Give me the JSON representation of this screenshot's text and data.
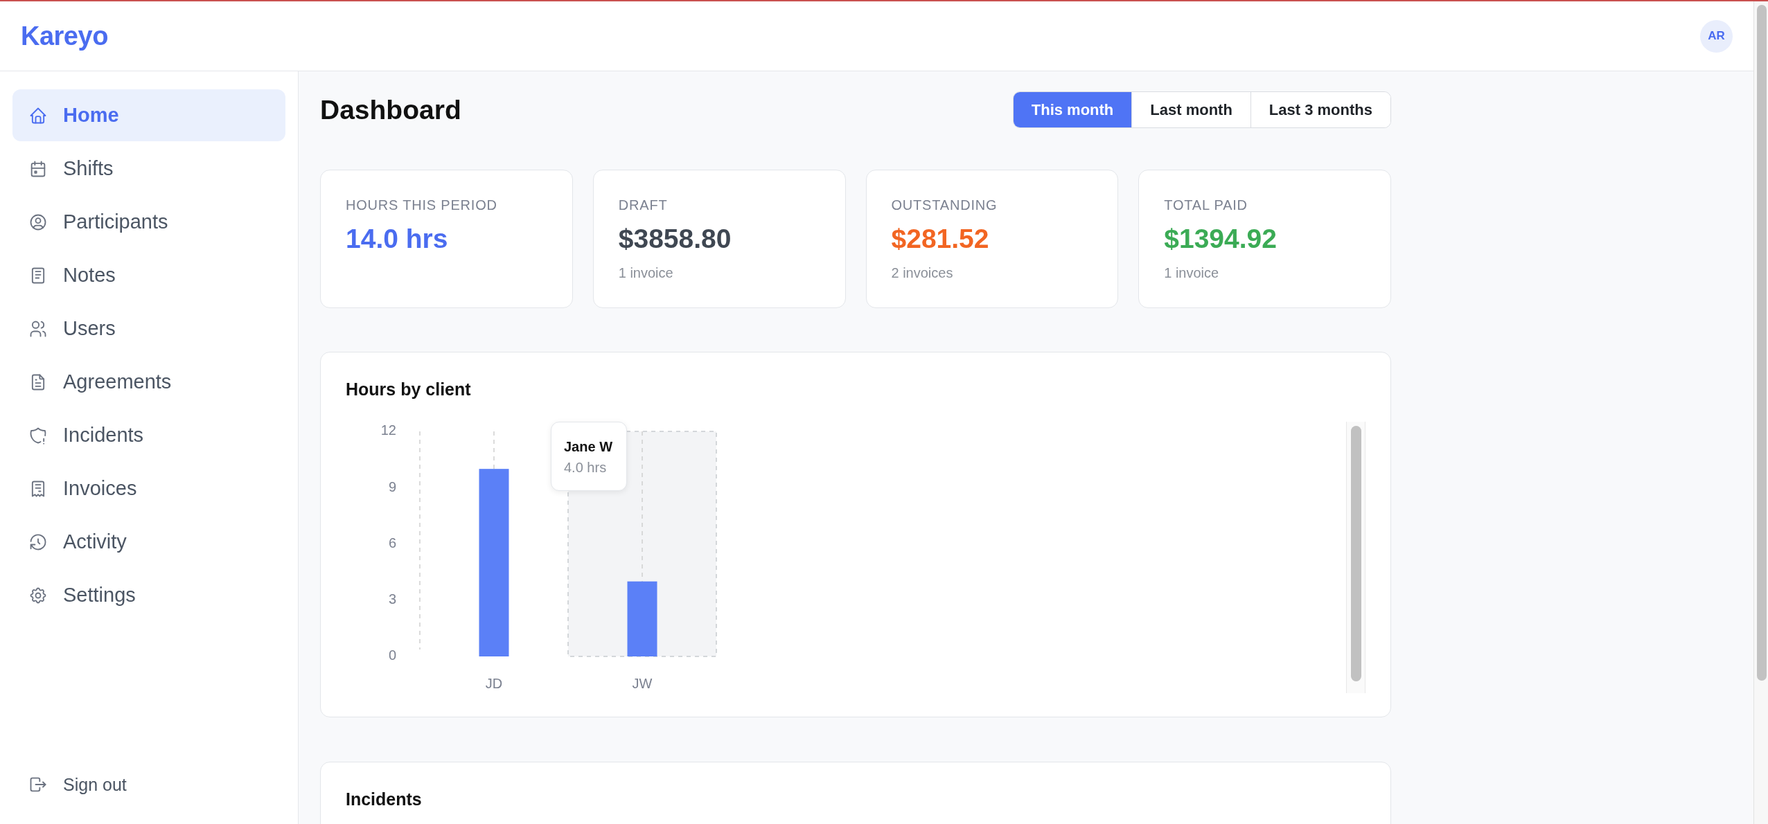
{
  "brand": "Kareyo",
  "user": {
    "initials": "AR"
  },
  "sidebar": {
    "items": [
      {
        "label": "Home",
        "selected": true
      },
      {
        "label": "Shifts",
        "selected": false
      },
      {
        "label": "Participants",
        "selected": false
      },
      {
        "label": "Notes",
        "selected": false
      },
      {
        "label": "Users",
        "selected": false
      },
      {
        "label": "Agreements",
        "selected": false
      },
      {
        "label": "Incidents",
        "selected": false
      },
      {
        "label": "Invoices",
        "selected": false
      },
      {
        "label": "Activity",
        "selected": false
      },
      {
        "label": "Settings",
        "selected": false
      }
    ],
    "sign_out": "Sign out"
  },
  "page": {
    "title": "Dashboard",
    "period_tabs": [
      {
        "label": "This month",
        "selected": true
      },
      {
        "label": "Last month",
        "selected": false
      },
      {
        "label": "Last 3 months",
        "selected": false
      }
    ]
  },
  "stats": [
    {
      "label": "HOURS THIS PERIOD",
      "value": "14.0 hrs",
      "color": "#4a6cf0"
    },
    {
      "label": "DRAFT",
      "value": "$3858.80",
      "note": "1 invoice",
      "color": "#3f4752"
    },
    {
      "label": "OUTSTANDING",
      "value": "$281.52",
      "note": "2 invoices",
      "color": "#f26522"
    },
    {
      "label": "TOTAL PAID",
      "value": "$1394.92",
      "note": "1 invoice",
      "color": "#3bab55"
    }
  ],
  "hours_chart": {
    "title": "Hours by client",
    "chart_data": {
      "type": "bar",
      "categories": [
        "JD",
        "JW"
      ],
      "series": [
        {
          "color": "#5b80f7",
          "values": [
            10,
            4
          ]
        }
      ],
      "ylim": [
        0,
        12
      ],
      "yticks": [
        0,
        3,
        6,
        9,
        12
      ]
    },
    "bands": [
      {
        "hovered": false
      },
      {
        "hovered": true
      }
    ],
    "tooltip": {
      "title": "Jane W",
      "value": "4.0 hrs"
    }
  },
  "incidents": {
    "title": "Incidents"
  }
}
